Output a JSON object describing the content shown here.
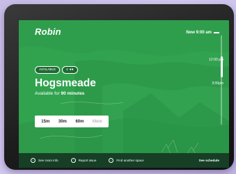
{
  "app": {
    "logo": "Robin"
  },
  "header": {
    "now_label": "Now 9:00 am"
  },
  "timeline": {
    "labels": [
      "12:00 pm",
      "3:00pm"
    ]
  },
  "room": {
    "status_badge": "AVAILABLE",
    "capacity": "4",
    "name": "Hogsmeade",
    "availability_prefix": "Available for",
    "availability_value": "90 minutes"
  },
  "booking": {
    "durations": [
      "15m",
      "30m",
      "60m"
    ],
    "more_label": "More"
  },
  "footer": {
    "room_info": "See room info",
    "report_issue": "Report issue",
    "find_space": "Find another space",
    "see_schedule": "See schedule"
  },
  "colors": {
    "screen_green": "#2f9e4c",
    "footer_green": "#163f26"
  }
}
